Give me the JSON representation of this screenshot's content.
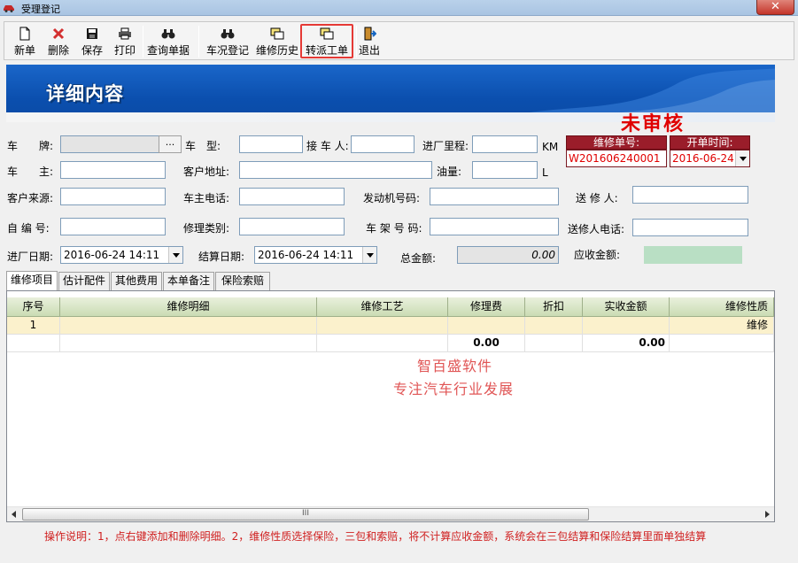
{
  "window": {
    "title": "受理登记",
    "close": "✕"
  },
  "toolbar": {
    "new": "新单",
    "delete": "删除",
    "save": "保存",
    "print": "打印",
    "query": "查询单据",
    "vehicle_check": "车况登记",
    "repair_history": "维修历史",
    "dispatch": "转派工单",
    "exit": "退出"
  },
  "banner": {
    "title": "详细内容"
  },
  "status": "未审核",
  "form": {
    "plate_label": "车　　牌:",
    "plate_value": "",
    "plate_btn": "...",
    "model_label": "车　型:",
    "model_value": "",
    "receiver_label": "接 车 人:",
    "receiver_value": "",
    "mileage_label": "进厂里程:",
    "mileage_value": "",
    "mileage_unit": "KM",
    "owner_label": "车　　主:",
    "owner_value": "",
    "address_label": "客户地址:",
    "address_value": "",
    "fuel_label": "油量:",
    "fuel_value": "",
    "fuel_unit": "L",
    "source_label": "客户来源:",
    "source_value": "",
    "phone_label": "车主电话:",
    "phone_value": "",
    "engine_label": "发动机号码:",
    "engine_value": "",
    "sender_label": "送 修 人:",
    "sender_value": "",
    "code_label": "自 编 号:",
    "code_value": "",
    "category_label": "修理类别:",
    "category_value": "",
    "frame_label": "车 架 号 码:",
    "frame_value": "",
    "sender_phone_label": "送修人电话:",
    "sender_phone_value": "",
    "entry_date_label": "进厂日期:",
    "entry_date_value": "2016-06-24 14:11",
    "settle_date_label": "结算日期:",
    "settle_date_value": "2016-06-24 14:11",
    "total_label": "总金额:",
    "total_value": "0.00",
    "receivable_label": "应收金额:",
    "receivable_value": ""
  },
  "repair_order": {
    "no_label": "维修单号:",
    "no_value": "W201606240001",
    "open_label": "开单时间:",
    "open_value": "2016-06-24"
  },
  "tabs": [
    "维修项目",
    "估计配件",
    "其他费用",
    "本单备注",
    "保险索赔"
  ],
  "grid": {
    "headers": [
      "序号",
      "维修明细",
      "维修工艺",
      "修理费",
      "折扣",
      "实收金额",
      "维修性质"
    ],
    "rows": [
      [
        "1",
        "",
        "",
        "",
        "",
        "",
        "维修"
      ],
      [
        "",
        "",
        "",
        "0.00",
        "",
        "0.00",
        ""
      ]
    ],
    "scroll_grip": "III"
  },
  "watermark": {
    "line1": "智百盛软件",
    "line2": "专注汽车行业发展"
  },
  "hint": "操作说明：1，点右键添加和删除明细。2，维修性质选择保险，三包和索赔，将不计算应收金额，系统会在三包结算和保险结算里面单独结算"
}
